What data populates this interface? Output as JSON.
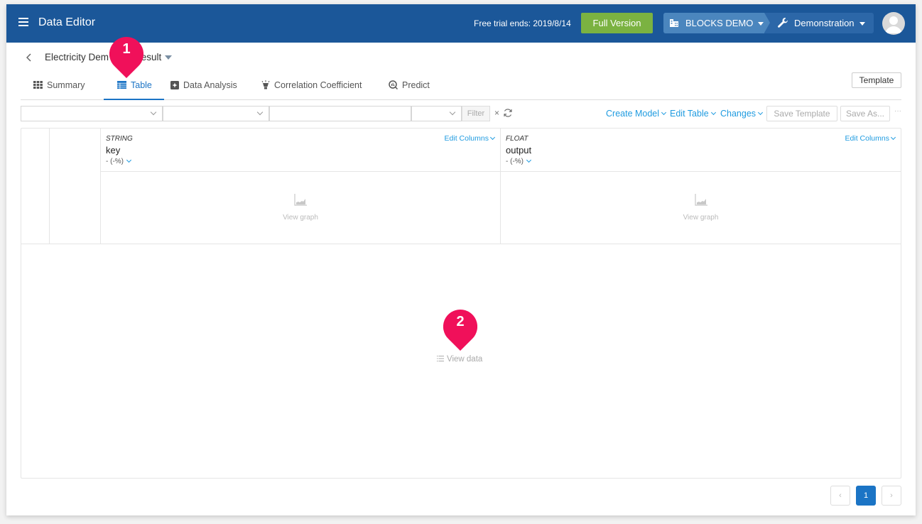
{
  "header": {
    "app_title": "Data Editor",
    "trial_text": "Free trial ends: 2019/8/14",
    "full_version_label": "Full Version",
    "organization": "BLOCKS DEMO",
    "project": "Demonstration",
    "colors": {
      "topbar": "#1b5799",
      "full_version": "#7bb241"
    }
  },
  "breadcrumb": {
    "back_icon": "chevron-left-icon",
    "dataset_name": "Electricity Dem_t_result",
    "dataset_name_visible_left": "Electricity Dem",
    "dataset_name_visible_right": "t_result"
  },
  "tabs": [
    {
      "label": "Summary",
      "icon": "grid-icon",
      "active": false
    },
    {
      "label": "Table",
      "icon": "table-icon",
      "active": true
    },
    {
      "label": "Data Analysis",
      "icon": "analysis-icon",
      "active": false
    },
    {
      "label": "Correlation Coefficient",
      "icon": "lightbulb-icon",
      "active": false
    },
    {
      "label": "Predict",
      "icon": "predict-icon",
      "active": false
    }
  ],
  "template_button": "Template",
  "filter_bar": {
    "select1_value": "",
    "select2_value": "",
    "input_value": "",
    "select3_value": "",
    "filter_label": "Filter",
    "clear_label": "×"
  },
  "toolbar": {
    "create_model": "Create Model",
    "edit_table": "Edit Table",
    "changes": "Changes",
    "save_template": "Save Template",
    "save_as": "Save As...",
    "more": "···"
  },
  "table": {
    "columns": [
      {
        "type": "STRING",
        "name": "key",
        "stat": "- (-%)",
        "edit_label": "Edit Columns",
        "graph_label": "View graph"
      },
      {
        "type": "FLOAT",
        "name": "output",
        "stat": "- (-%)",
        "edit_label": "Edit Columns",
        "graph_label": "View graph"
      }
    ],
    "view_data_label": "View data"
  },
  "pagination": {
    "prev": "‹",
    "current": "1",
    "next": "›"
  },
  "markers": [
    {
      "number": "1",
      "color": "#f0105a"
    },
    {
      "number": "2",
      "color": "#f0105a"
    }
  ]
}
